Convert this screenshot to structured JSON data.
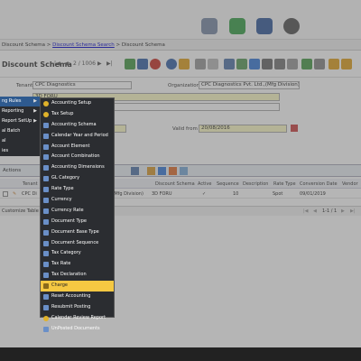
{
  "breadcrumb": {
    "current_left": "Discount Schema",
    "link": "Discount Schema Search",
    "current_right": "Discount Schema"
  },
  "window": {
    "title": "Discount Schema",
    "record_nav": "2 / 1006"
  },
  "form": {
    "tenant_label": "Tenant",
    "tenant_value": "CPC Diagnostics",
    "org_label": "Organization",
    "org_value": "CPC Diagnostics Pvt. Ltd.,(Mfg Division)",
    "search_key_value": "3D FORU",
    "valid_from_label": "Valid from",
    "valid_from_value": "20/08/2016"
  },
  "grid": {
    "actions_label": "Actions",
    "headers": [
      "Tenant",
      "Discount Schema",
      "Active",
      "Sequence",
      "Description",
      "Rate Type",
      "Conversion Date",
      "Vendor"
    ],
    "row": {
      "tenant": "CPC Di",
      "org_tail": "L.(Mfg Division)",
      "discount_schema": "3D FORU",
      "active": "✓",
      "sequence": "10",
      "description": "",
      "rate_type": "Spot",
      "conversion_date": "09/01/2019",
      "vendor": ""
    },
    "footer_left": "Customize Table",
    "pager": "1-1 / 1"
  },
  "side_menu": {
    "items": [
      {
        "label": "ng Rules",
        "active": true,
        "has_sub": true
      },
      {
        "label": "Reporting",
        "active": false,
        "has_sub": true
      },
      {
        "label": "Report SetUp",
        "active": false,
        "has_sub": true
      },
      {
        "label": "al Batch",
        "active": false,
        "has_sub": false
      },
      {
        "label": "al",
        "active": false,
        "has_sub": false
      },
      {
        "label": "ies",
        "active": false,
        "has_sub": false
      }
    ]
  },
  "sub_menu": {
    "items": [
      {
        "label": "Accounting Setup",
        "icon": "wand-icon"
      },
      {
        "label": "Tax Setup",
        "icon": "wand-icon"
      },
      {
        "label": "Accounting Schema",
        "icon": "window-icon"
      },
      {
        "label": "Calendar Year and Period",
        "icon": "window-icon"
      },
      {
        "label": "Account Element",
        "icon": "window-icon"
      },
      {
        "label": "Account Combination",
        "icon": "window-icon"
      },
      {
        "label": "Accounting Dimensions",
        "icon": "window-icon"
      },
      {
        "label": "GL Category",
        "icon": "window-icon"
      },
      {
        "label": "Rate Type",
        "icon": "window-icon"
      },
      {
        "label": "Currency",
        "icon": "window-icon"
      },
      {
        "label": "Currency Rate",
        "icon": "window-icon"
      },
      {
        "label": "Document Type",
        "icon": "window-icon"
      },
      {
        "label": "Document Base Type",
        "icon": "window-icon"
      },
      {
        "label": "Document Sequence",
        "icon": "window-icon"
      },
      {
        "label": "Tax Category",
        "icon": "window-icon"
      },
      {
        "label": "Tax Rate",
        "icon": "window-icon"
      },
      {
        "label": "Tax Declaration",
        "icon": "window-icon"
      },
      {
        "label": "Charge",
        "icon": "window-icon",
        "highlight": true
      },
      {
        "label": "Reset Accounting",
        "icon": "process-icon"
      },
      {
        "label": "Resubmit Posting",
        "icon": "process-icon"
      },
      {
        "label": "Calendar Review Report",
        "icon": "report-icon"
      },
      {
        "label": "UnPosted Documents",
        "icon": "window-icon"
      }
    ]
  }
}
